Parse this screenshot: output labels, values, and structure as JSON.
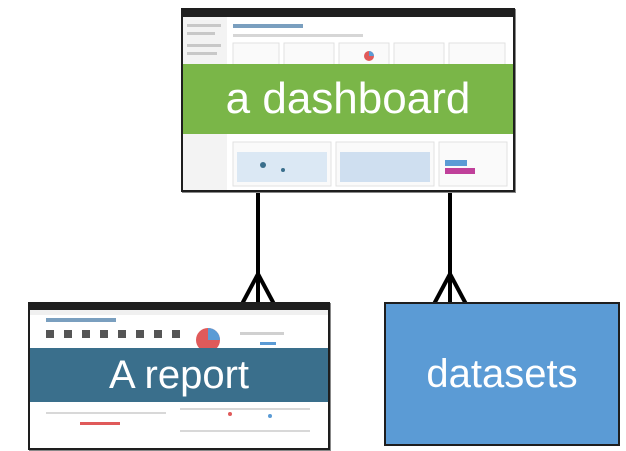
{
  "dashboard": {
    "label": "a dashboard"
  },
  "report": {
    "label": "A report"
  },
  "datasets": {
    "label": "datasets"
  },
  "colors": {
    "dashboard_banner": "#7ab648",
    "report_banner": "#3a6f8c",
    "datasets_box": "#5b9bd5",
    "connector": "#000000",
    "titlebar": "#1f1f1f"
  },
  "relationships": [
    {
      "from": "dashboard",
      "to": "report",
      "notation": "one-to-many"
    },
    {
      "from": "dashboard",
      "to": "datasets",
      "notation": "one-to-many"
    }
  ]
}
